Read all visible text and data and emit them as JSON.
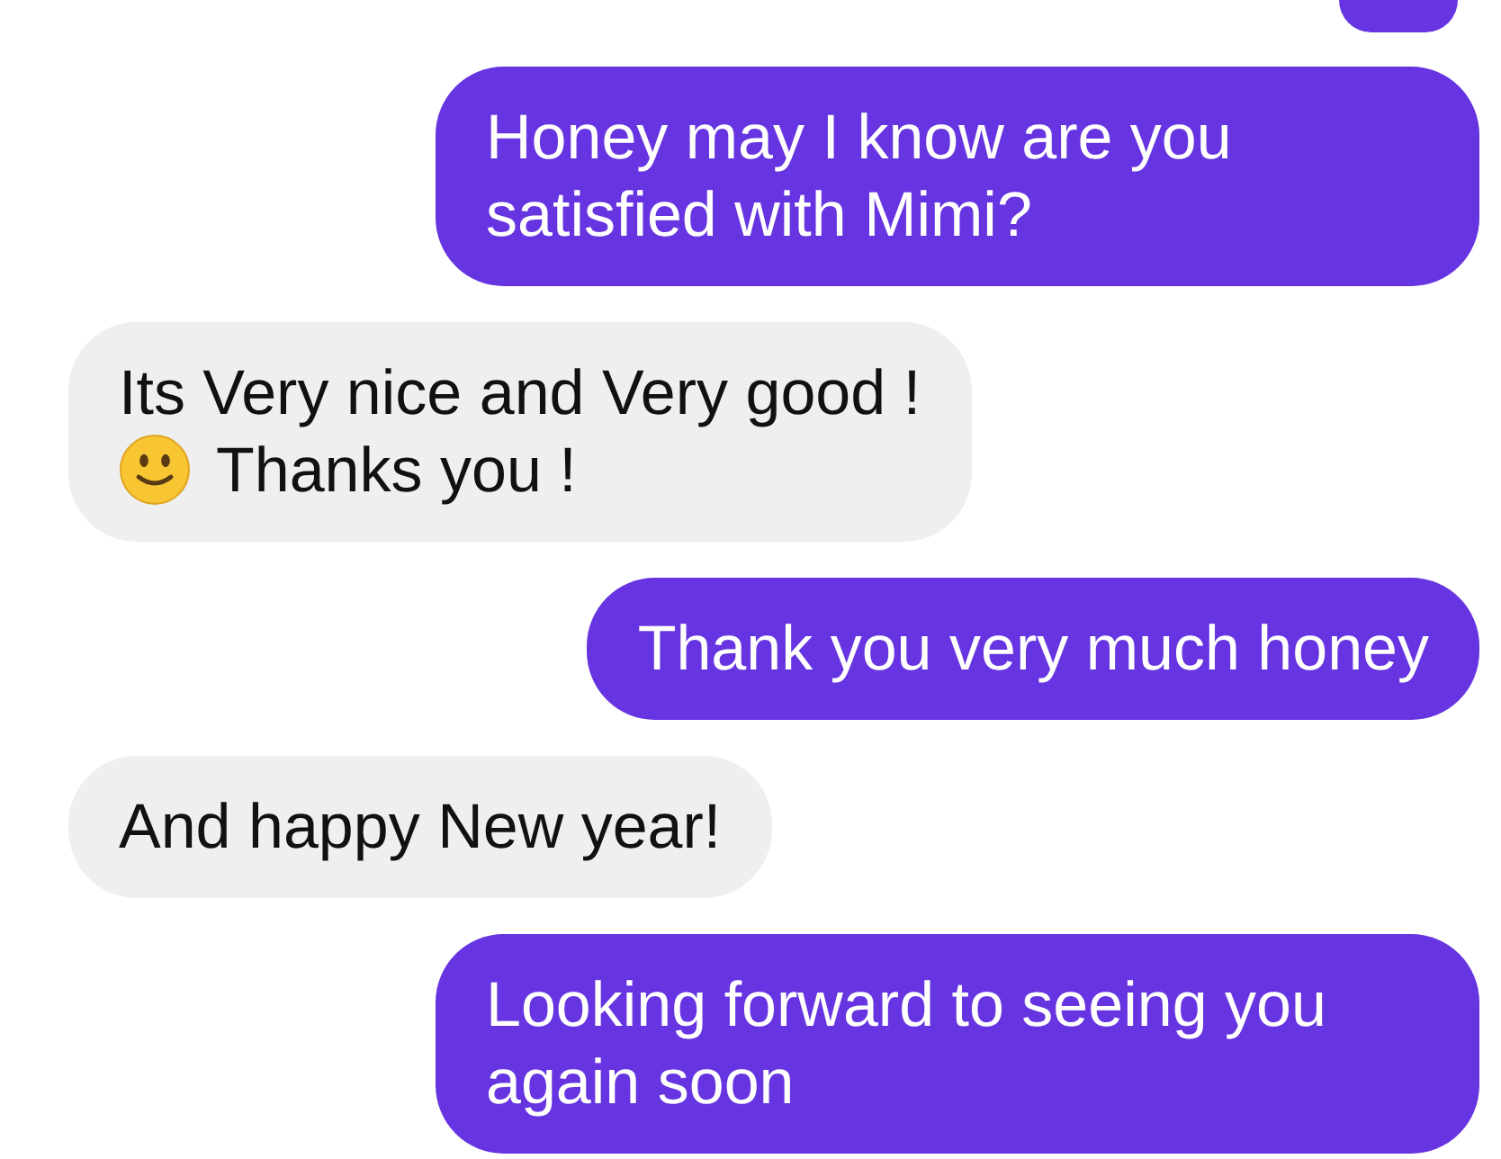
{
  "previous_bubble": {
    "kind": "outgoing"
  },
  "messages": [
    {
      "kind": "outgoing",
      "segments": [
        {
          "kind": "text",
          "text": "Honey may I know are you satisfied with Mimi?"
        }
      ]
    },
    {
      "kind": "incoming",
      "segments": [
        {
          "kind": "text",
          "text": "Its Very nice and Very good !"
        },
        {
          "kind": "newline"
        },
        {
          "kind": "emoji"
        },
        {
          "kind": "text",
          "text": "Thanks you !"
        }
      ]
    },
    {
      "kind": "outgoing",
      "segments": [
        {
          "kind": "text",
          "text": "Thank you very much honey"
        }
      ]
    },
    {
      "kind": "incoming",
      "segments": [
        {
          "kind": "text",
          "text": "And happy New year!"
        }
      ]
    },
    {
      "kind": "outgoing",
      "segments": [
        {
          "kind": "text",
          "text": "Looking forward to seeing you again soon"
        }
      ]
    }
  ]
}
